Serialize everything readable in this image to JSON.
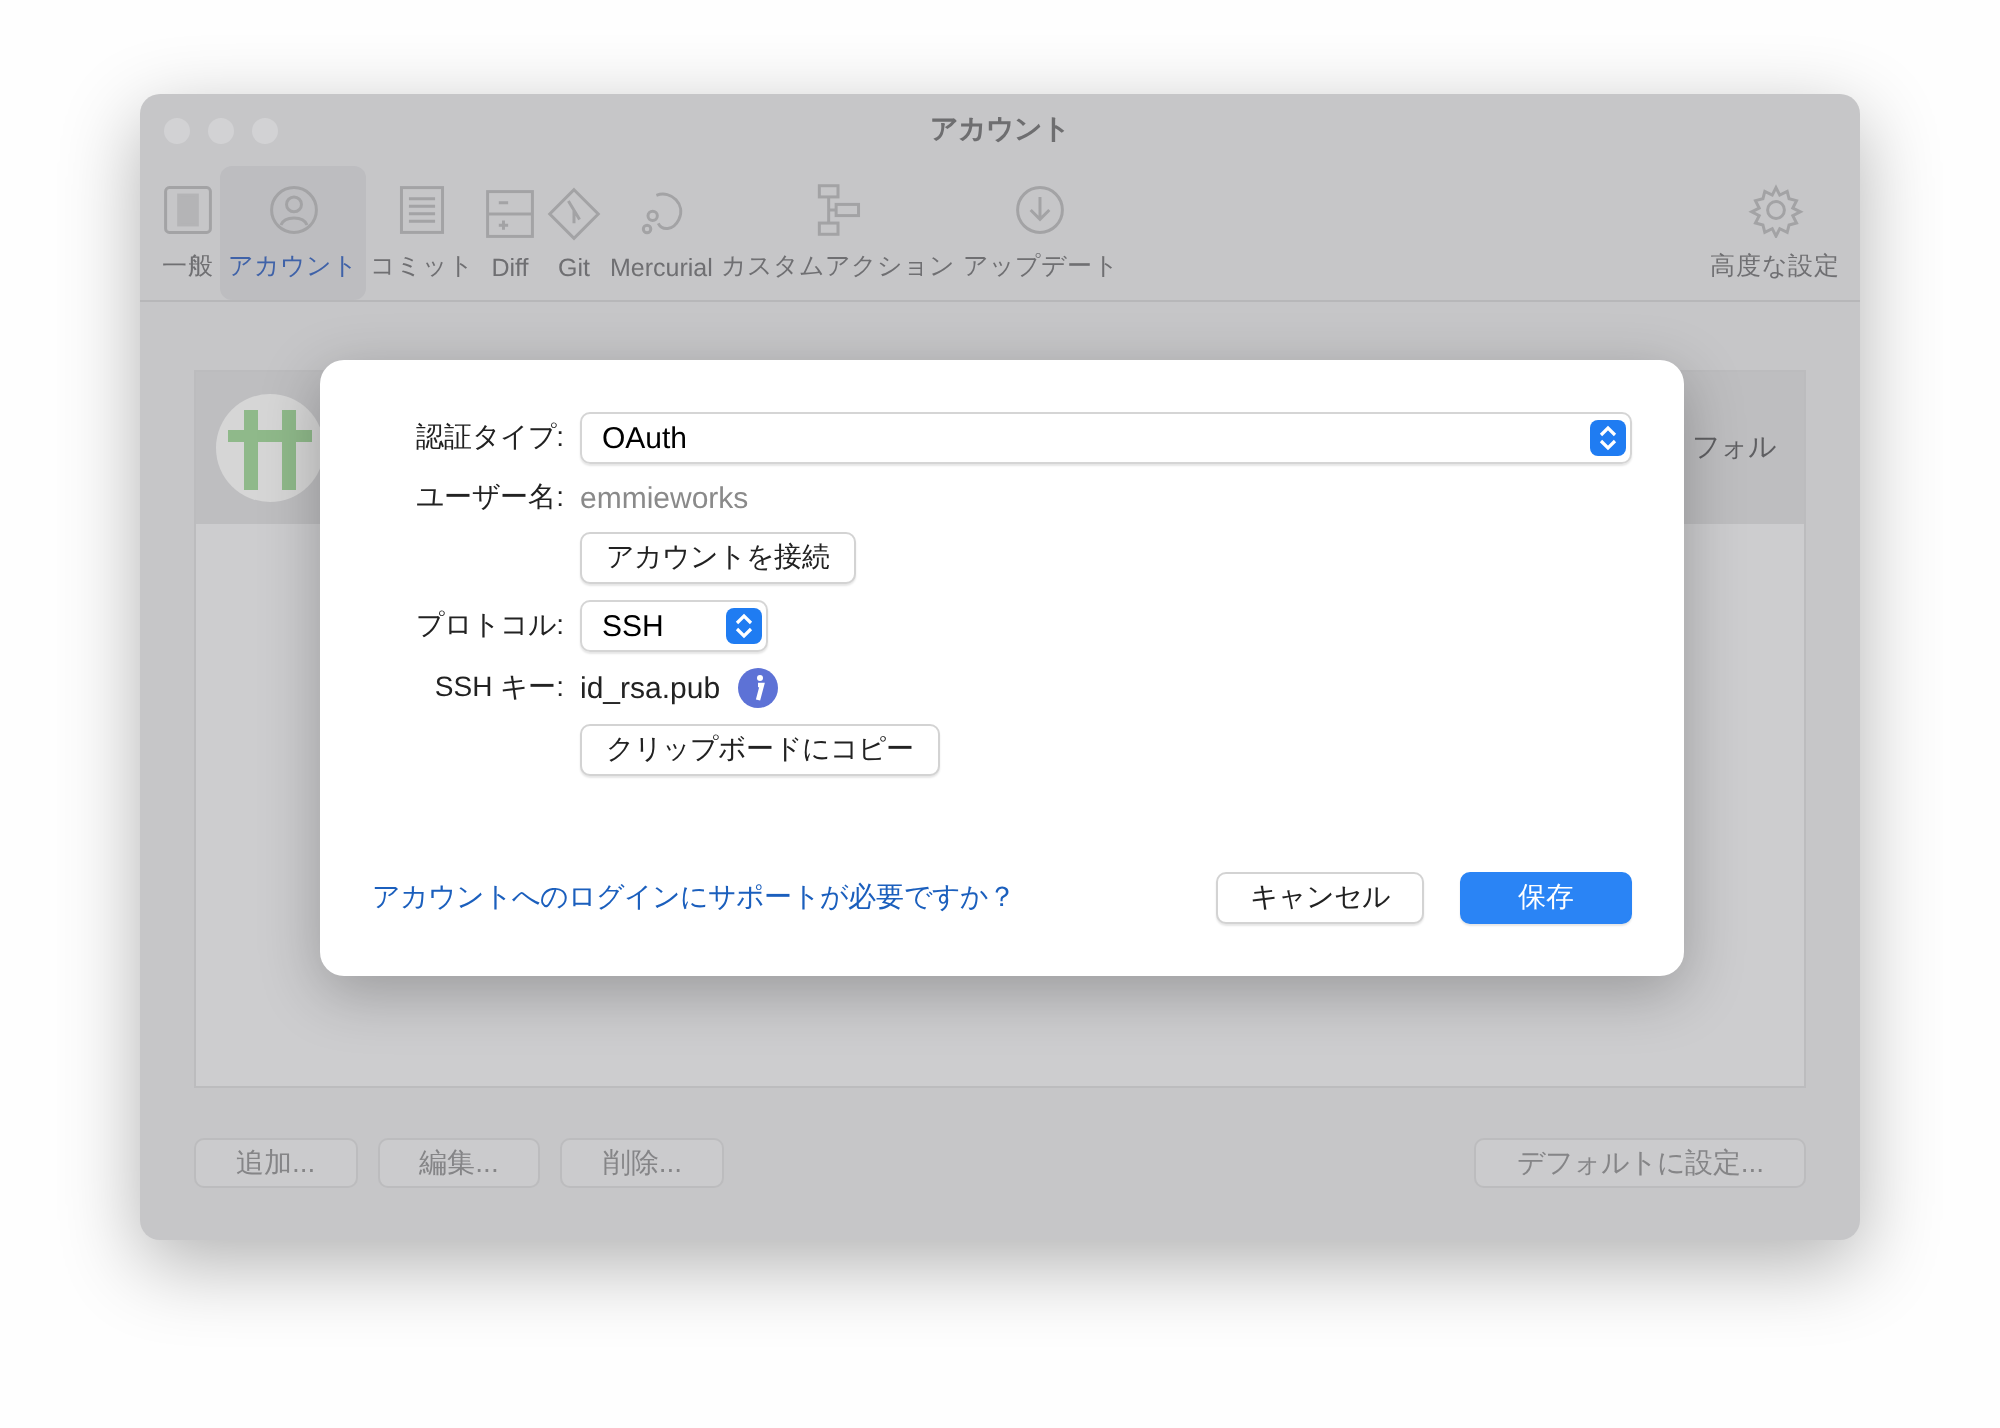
{
  "window": {
    "title": "アカウント"
  },
  "toolbar": {
    "items": [
      {
        "kind": "general",
        "label": "一般",
        "selected": false
      },
      {
        "kind": "account",
        "label": "アカウント",
        "selected": true
      },
      {
        "kind": "commit",
        "label": "コミット",
        "selected": false
      },
      {
        "kind": "diff",
        "label": "Diff",
        "selected": false
      },
      {
        "kind": "git",
        "label": "Git",
        "selected": false
      },
      {
        "kind": "mercurial",
        "label": "Mercurial",
        "selected": false
      },
      {
        "kind": "custom",
        "label": "カスタムアクション",
        "selected": false
      },
      {
        "kind": "update",
        "label": "アップデート",
        "selected": false
      }
    ],
    "advanced": {
      "label": "高度な設定"
    }
  },
  "account_list": {
    "rows": [
      {
        "text": "フォル"
      }
    ]
  },
  "footer": {
    "left_buttons": [
      "追加...",
      "編集...",
      "削除..."
    ],
    "right_button": "デフォルトに設定..."
  },
  "dialog": {
    "auth_type": {
      "label": "認証タイプ:",
      "value": "OAuth"
    },
    "username": {
      "label": "ユーザー名:",
      "value": "emmieworks"
    },
    "connect_button": "アカウントを接続",
    "protocol": {
      "label": "プロトコル:",
      "value": "SSH"
    },
    "ssh_key": {
      "label": "SSH キー:",
      "value": "id_rsa.pub"
    },
    "copy_button": "クリップボードにコピー",
    "help_link": "アカウントへのログインにサポートが必要ですか？",
    "cancel_button": "キャンセル",
    "save_button": "保存"
  }
}
